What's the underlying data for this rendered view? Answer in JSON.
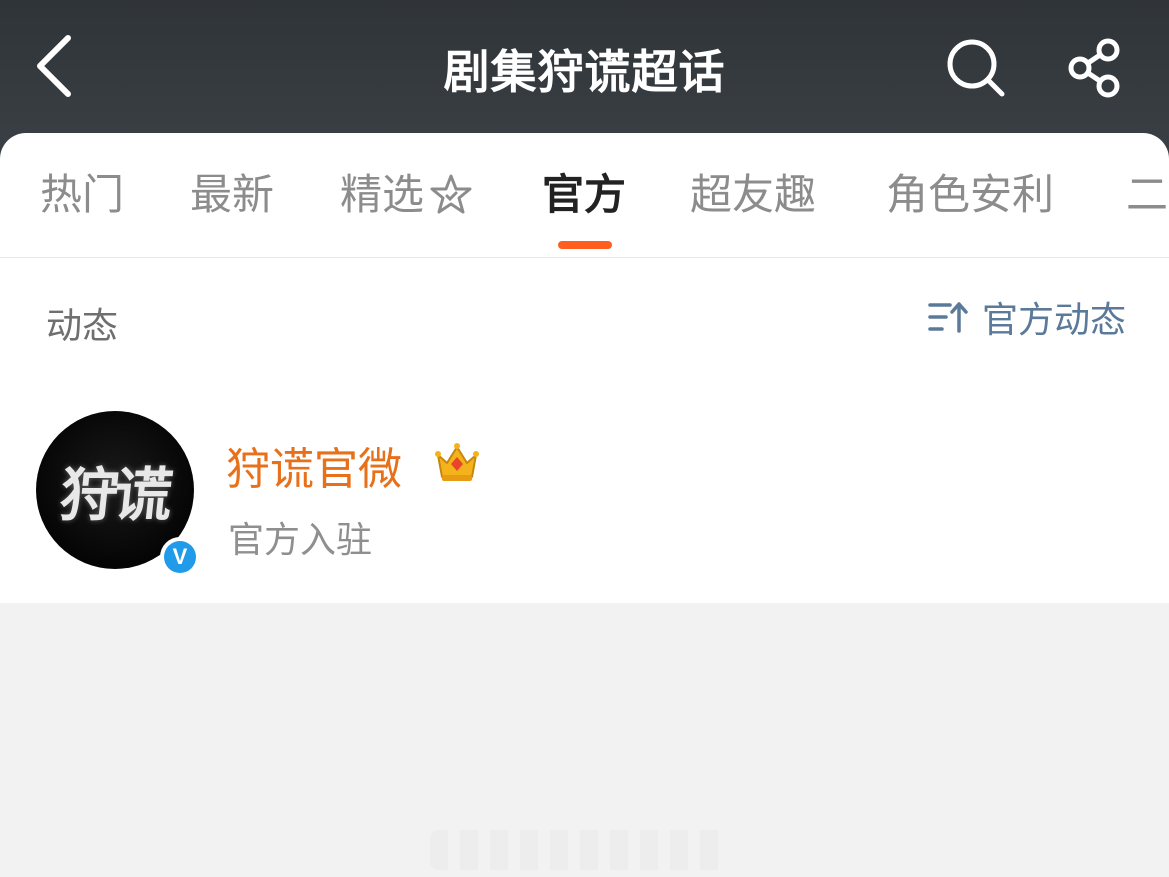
{
  "header": {
    "title": "剧集狩谎超话",
    "back_icon": "chevron-left-icon",
    "search_icon": "search-icon",
    "share_icon": "share-icon"
  },
  "tabs": [
    {
      "label": "热门",
      "active": false
    },
    {
      "label": "最新",
      "active": false
    },
    {
      "label": "精选",
      "active": false,
      "icon": "star-icon"
    },
    {
      "label": "官方",
      "active": true
    },
    {
      "label": "超友趣",
      "active": false
    },
    {
      "label": "角色安利",
      "active": false
    },
    {
      "label": "二",
      "active": false
    }
  ],
  "section": {
    "label": "动态",
    "sort_label": "官方动态",
    "sort_icon": "sort-icon"
  },
  "account": {
    "avatar_text": "狩谎",
    "name": "狩谎官微",
    "subtitle": "官方入驻",
    "verified_mark": "V",
    "badge_icon": "crown-icon"
  },
  "colors": {
    "header_bg": "#343a3e",
    "active_tab_indicator": "#ff5e1f",
    "account_name": "#e8701a",
    "sort_link": "#5b7a99",
    "verified": "#1f9bea"
  }
}
